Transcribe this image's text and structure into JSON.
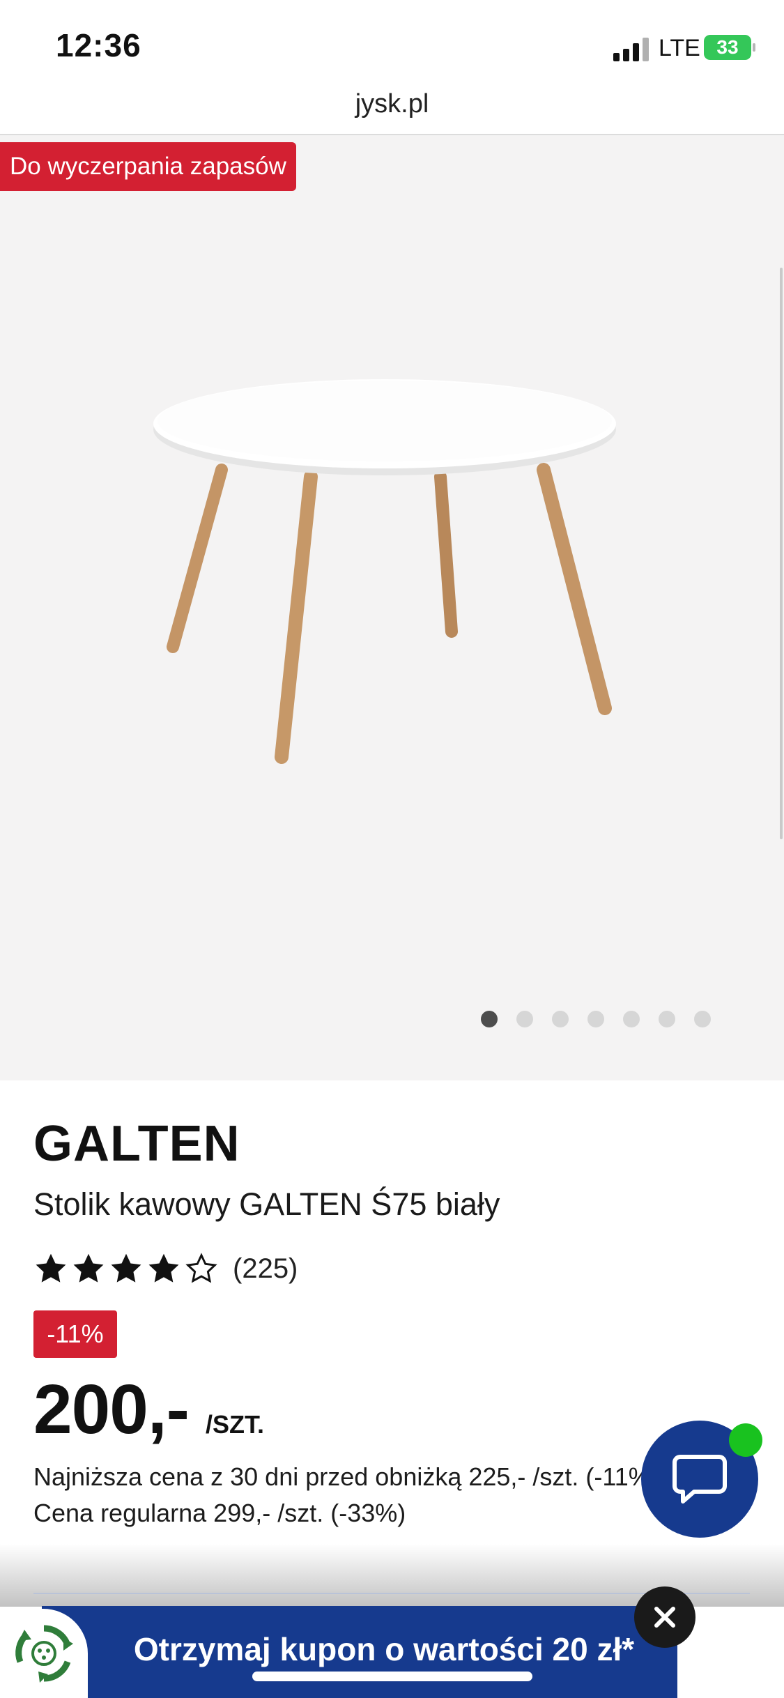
{
  "status_bar": {
    "time": "12:36",
    "network": "LTE",
    "battery": "33",
    "icons": [
      "signal-icon",
      "battery-charging-icon"
    ]
  },
  "browser": {
    "url": "jysk.pl"
  },
  "gallery": {
    "badge": "Do wyczerpania zapasów",
    "image_count": 7,
    "active_index": 0
  },
  "product": {
    "brand": "GALTEN",
    "title": "Stolik kawowy GALTEN Ś75 biały",
    "rating": 4,
    "rating_max": 5,
    "review_count": "(225)",
    "discount": "-11%",
    "price": "200,-",
    "price_unit": "/SZT.",
    "lowest_price_note": "Najniższa cena z 30 dni przed obniżką 225,- /szt. (-11%)",
    "regular_price_note": "Cena regularna 299,- /szt. (-33%)"
  },
  "coupon": {
    "text": "Otrzymaj kupon o wartości 20 zł*"
  },
  "colors": {
    "brand_blue": "#163a8e",
    "sale_red": "#d32032",
    "online_green": "#19c21f"
  }
}
